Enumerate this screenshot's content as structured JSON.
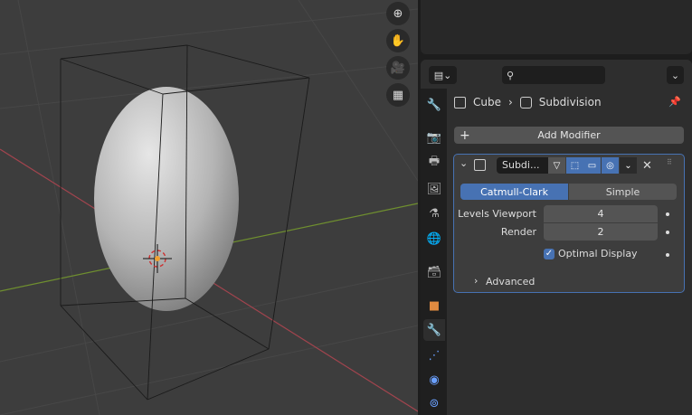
{
  "viewport": {
    "nav_icons": [
      "zoom-icon",
      "hand-pan-icon",
      "camera-icon",
      "perspective-grid-icon"
    ],
    "axis_colors": {
      "x": "#b34a55",
      "y": "#6f8f2f"
    }
  },
  "header": {
    "search_placeholder": ""
  },
  "breadcrumb": {
    "object": "Cube",
    "modifier": "Subdivision"
  },
  "add_modifier": "Add Modifier",
  "modifier": {
    "name": "Subdi...",
    "method_options": [
      "Catmull-Clark",
      "Simple"
    ],
    "selected_method": "Catmull-Clark",
    "levels_viewport_label": "Levels Viewport",
    "levels_viewport": "4",
    "render_label": "Render",
    "render": "2",
    "optimal_display_label": "Optimal Display",
    "optimal_display": true,
    "advanced_label": "Advanced"
  },
  "colors": {
    "accent": "#4772b3",
    "active_tab": "#6aa0ff"
  }
}
